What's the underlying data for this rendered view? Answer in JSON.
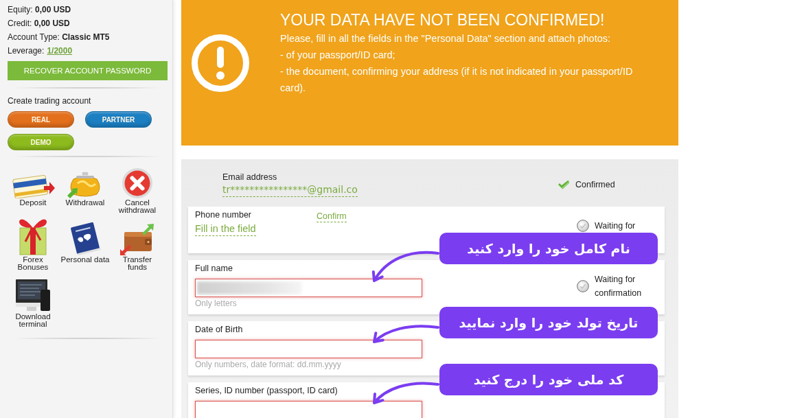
{
  "sidebar": {
    "account_info": [
      {
        "kind": "text",
        "label": "Equity:",
        "value": "0,00 USD"
      },
      {
        "kind": "text",
        "label": "Credit:",
        "value": "0,00 USD"
      },
      {
        "kind": "text",
        "label": "Account Type:",
        "value": "Classic MT5"
      },
      {
        "kind": "link",
        "label": "Leverage:",
        "value": "1/2000"
      }
    ],
    "recover_button": "RECOVER ACCOUNT PASSWORD",
    "create_account": {
      "title": "Create trading account",
      "buttons": [
        {
          "label": "REAL",
          "color": "#e3701c"
        },
        {
          "label": "PARTNER",
          "color": "#1b7fc2"
        },
        {
          "label": "DEMO",
          "color": "#8dbb1e"
        }
      ]
    },
    "actions": [
      {
        "kind": "deposit",
        "label": "Deposit"
      },
      {
        "kind": "withdrawal",
        "label": "Withdrawal"
      },
      {
        "kind": "cancel",
        "label": "Cancel withdrawal"
      },
      {
        "kind": "bonus",
        "label": "Forex Bonuses"
      },
      {
        "kind": "profile",
        "label": "Personal data"
      },
      {
        "kind": "transfer",
        "label": "Transfer funds"
      },
      {
        "kind": "download",
        "label": "Download terminal"
      }
    ]
  },
  "alert": {
    "title": "YOUR DATA HAVE NOT BEEN CONFIRMED!",
    "message": "Please, fill in all the fields in the \"Personal Data\" section and attach photos:",
    "items": [
      "- of your passport/ID card;",
      "- the document, confirming your address (if it is not indicated in your passport/ID card)."
    ]
  },
  "verification": {
    "email": {
      "label": "Email address",
      "value": "tr****************@gmail.co",
      "status": "Confirmed",
      "confirmed": true
    },
    "fields": [
      {
        "kind": "phone",
        "label": "Phone number",
        "link": "Fill in the field",
        "action": "Confirm",
        "status": "Waiting for",
        "confirmed": false
      },
      {
        "kind": "input",
        "label": "Full name",
        "redacted": true,
        "invalid": true,
        "hint": "Only letters",
        "status": "Waiting for confirmation",
        "confirmed": false,
        "callout": "نام کامل خود را وارد کنید"
      },
      {
        "kind": "input",
        "label": "Date of Birth",
        "redacted": false,
        "invalid": true,
        "hint": "Only numbers, date format: dd.mm.yyyy",
        "callout": "تاریخ تولد خود را وارد نمایید"
      },
      {
        "kind": "input",
        "label": "Series, ID number (passport, ID card)",
        "redacted": false,
        "invalid": true,
        "callout": "کد ملی خود را درج کنید"
      }
    ]
  }
}
